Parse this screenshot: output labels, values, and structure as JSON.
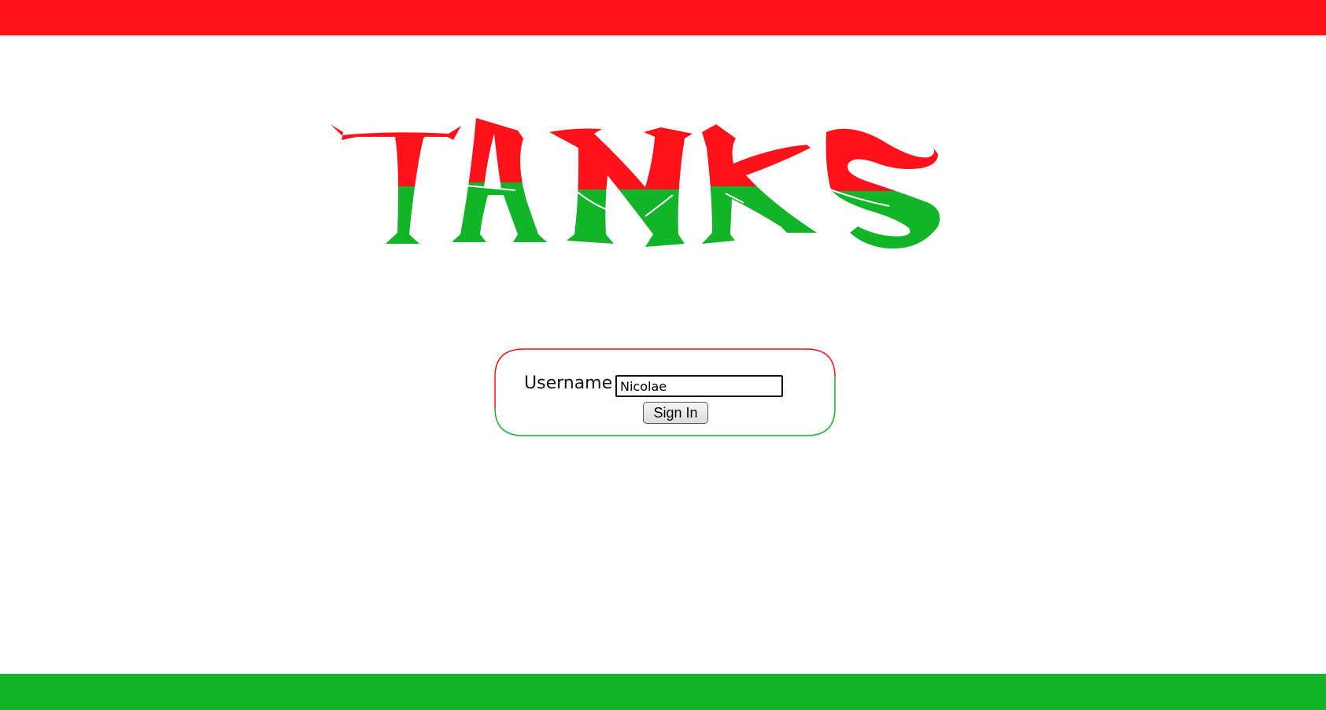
{
  "app": {
    "title": "TANKS"
  },
  "theme": {
    "red": "#ff121c",
    "green": "#13b32a",
    "background": "#ffffff"
  },
  "login": {
    "username_label": "Username :",
    "username_value": "Nicolae",
    "signin_label": "Sign In"
  }
}
